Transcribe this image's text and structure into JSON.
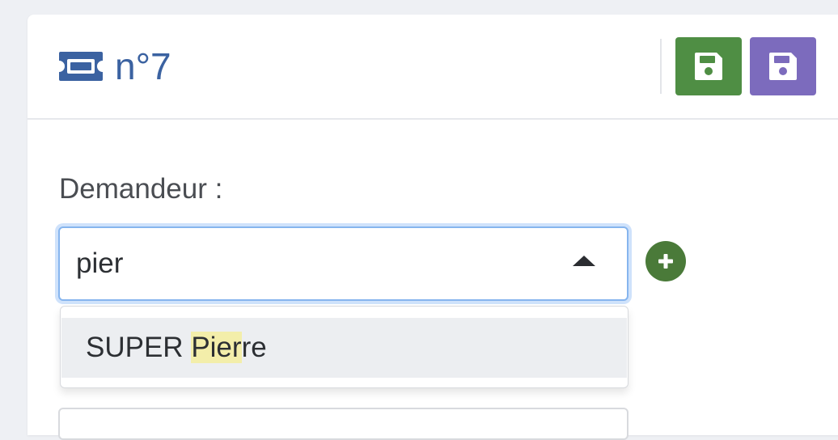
{
  "header": {
    "title": "n°7",
    "icons": {
      "title": "ticket-icon",
      "save": "floppy-disk-icon",
      "save_alt": "floppy-disk-icon"
    },
    "colors": {
      "title": "#3b62a1",
      "save_button": "#4f8e44",
      "save_alt_button": "#7c6bbd"
    }
  },
  "form": {
    "requester": {
      "label": "Demandeur :",
      "value": "pier",
      "add_icon": "plus-circle-icon",
      "dropdown": {
        "options": [
          {
            "before": "SUPER ",
            "match": "Pier",
            "after": "re"
          }
        ]
      }
    }
  }
}
